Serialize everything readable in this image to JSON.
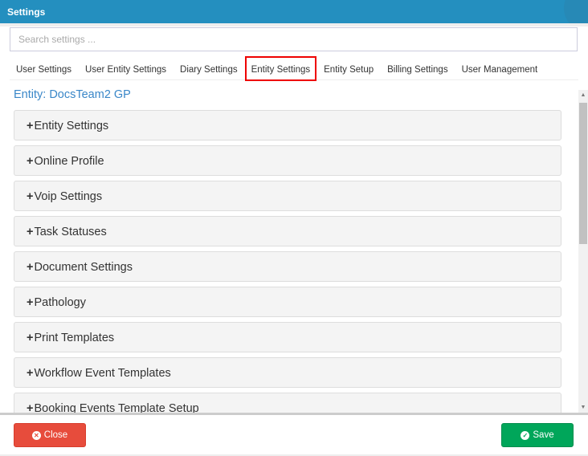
{
  "header": {
    "title": "Settings"
  },
  "search": {
    "placeholder": "Search settings ..."
  },
  "tabs": [
    {
      "label": "User Settings"
    },
    {
      "label": "User Entity Settings"
    },
    {
      "label": "Diary Settings"
    },
    {
      "label": "Entity Settings",
      "active": true
    },
    {
      "label": "Entity Setup"
    },
    {
      "label": "Billing Settings"
    },
    {
      "label": "User Management"
    }
  ],
  "entity_title": "Entity: DocsTeam2 GP",
  "panels": [
    {
      "label": "Entity Settings"
    },
    {
      "label": "Online Profile"
    },
    {
      "label": "Voip Settings"
    },
    {
      "label": "Task Statuses"
    },
    {
      "label": "Document Settings"
    },
    {
      "label": "Pathology"
    },
    {
      "label": "Print Templates"
    },
    {
      "label": "Workflow Event Templates"
    },
    {
      "label": "Booking Events Template Setup"
    }
  ],
  "expand_symbol": "+",
  "footer": {
    "close_label": "Close",
    "save_label": "Save"
  },
  "colors": {
    "header": "#248fbf",
    "close": "#e74c3c",
    "save": "#00a65a",
    "highlight": "#ee0000"
  }
}
